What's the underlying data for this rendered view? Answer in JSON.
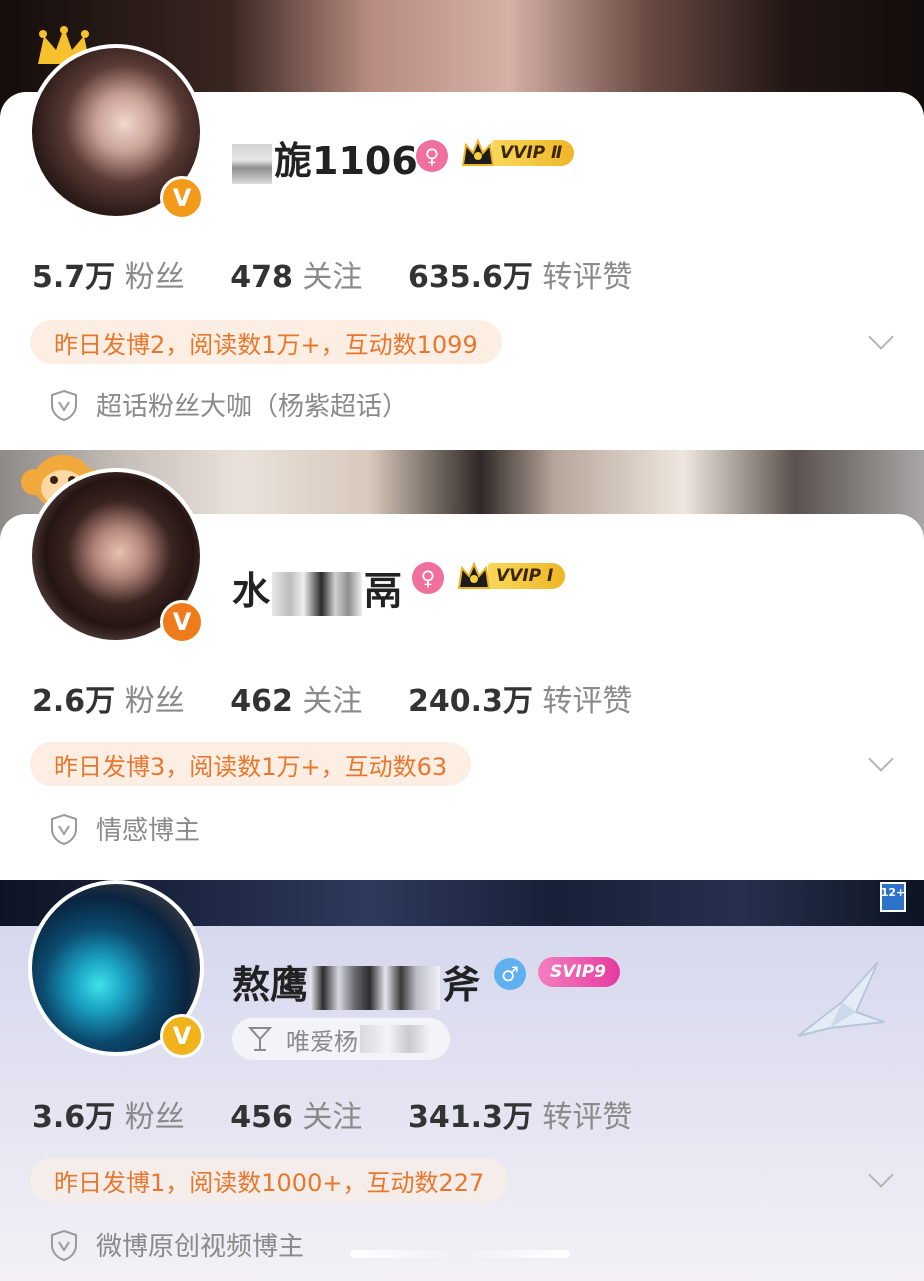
{
  "profiles": [
    {
      "name_visible": "旎1106",
      "vip_label": "VVIP Ⅱ",
      "gender_icon": "female-icon",
      "stats": {
        "fans_value": "5.7万",
        "fans_label": "粉丝",
        "following_value": "478",
        "following_label": "关注",
        "engagement_value": "635.6万",
        "engagement_label": "转评赞"
      },
      "activity": "昨日发博2，阅读数1万+，互动数1099",
      "tag": "超话粉丝大咖（杨紫超话）"
    },
    {
      "name_prefix": "水",
      "name_suffix": "鬲",
      "vip_label": "VVIP Ⅰ",
      "gender_icon": "female-icon",
      "stats": {
        "fans_value": "2.6万",
        "fans_label": "粉丝",
        "following_value": "462",
        "following_label": "关注",
        "engagement_value": "240.3万",
        "engagement_label": "转评赞"
      },
      "activity": "昨日发博3，阅读数1万+，互动数63",
      "tag": "情感博主"
    },
    {
      "name_prefix": "熬鹰",
      "name_suffix": "斧",
      "vip_label": "SVIP9",
      "gender_icon": "male-icon",
      "sub_tag": "唯爱杨",
      "stats": {
        "fans_value": "3.6万",
        "fans_label": "粉丝",
        "following_value": "456",
        "following_label": "关注",
        "engagement_value": "341.3万",
        "engagement_label": "转评赞"
      },
      "activity": "昨日发博1，阅读数1000+，互动数227",
      "tag": "微博原创视频博主"
    }
  ],
  "badges": {
    "verified": "V",
    "age_rating": "12+"
  },
  "colors": {
    "activity_text": "#e8772e",
    "activity_bg": "#fdeee3",
    "verified_orange": "#f39a1b",
    "female_pink": "#f0709b",
    "male_blue": "#5fb0ee"
  }
}
